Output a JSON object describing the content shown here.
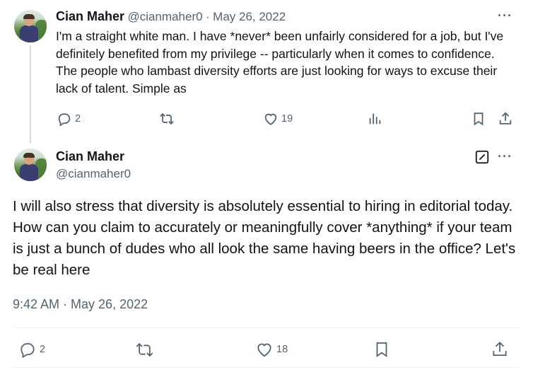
{
  "tweet1": {
    "name": "Cian Maher",
    "handle": "@cianmaher0",
    "dot": "·",
    "date": "May 26, 2022",
    "more": "···",
    "text": "I'm a straight white man. I have *never* been unfairly considered for a job, but I've definitely benefited from my privilege -- particularly when it comes to confidence. The people who lambast diversity efforts are just looking for ways to excuse their lack of talent. Simple as",
    "replies": "2",
    "likes": "19"
  },
  "tweet2": {
    "name": "Cian Maher",
    "handle": "@cianmaher0",
    "more": "···",
    "text": "I will also stress that diversity is absolutely essential to hiring in editorial today. How can you claim to accurately or meaningfully cover *anything* if your team is just a bunch of dudes who all look the same having beers in the office? Let's be real here",
    "timestamp": "9:42 AM · May 26, 2022",
    "replies": "2",
    "likes": "18"
  },
  "icons": {
    "reply": "reply-icon",
    "retweet": "retweet-icon",
    "like": "heart-icon",
    "views": "analytics-icon",
    "bookmark": "bookmark-icon",
    "share": "share-icon",
    "edit": "edit-icon"
  },
  "colors": {
    "text": "#0f1419",
    "muted": "#536471",
    "divider": "#eff3f4",
    "thread": "#cfd9de"
  }
}
